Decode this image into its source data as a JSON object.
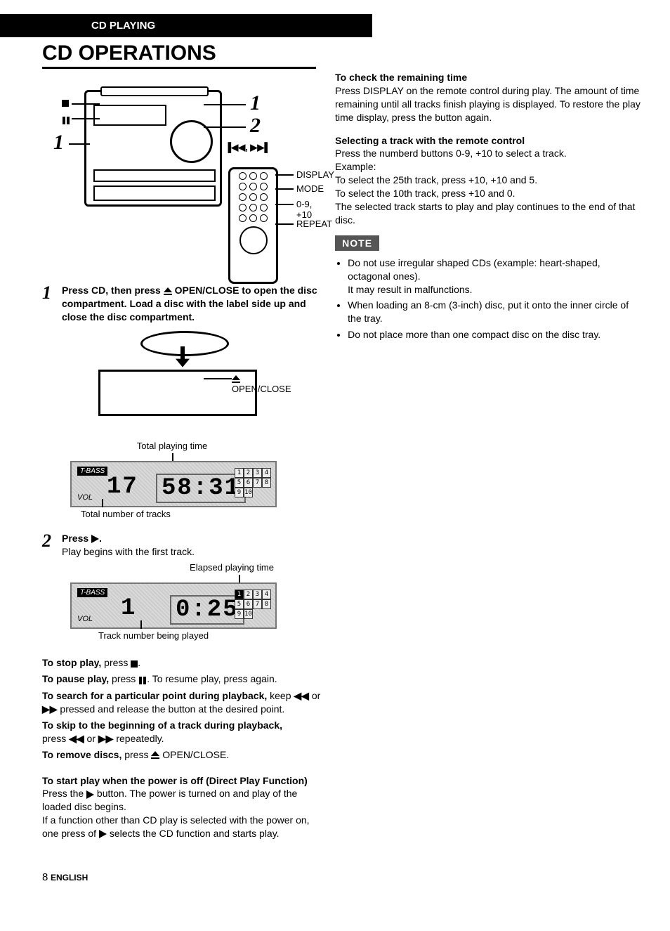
{
  "header": {
    "section": "CD PLAYING"
  },
  "title": "CD OPERATIONS",
  "diagram_main": {
    "callouts_left": {
      "stop": "■",
      "pause": "❙❙",
      "num_left": "1"
    },
    "callouts_right": {
      "num1": "1",
      "num2": "2",
      "skip": "▐◀◀, ▶▶▌",
      "display": "DISPLAY",
      "mode": "MODE",
      "digits": "0-9, +10",
      "repeat": "REPEAT"
    }
  },
  "step1": {
    "num": "1",
    "bold": "Press CD, then press ",
    "eject_label": " OPEN/CLOSE to open the disc compartment.  Load a disc with the label side up and close the disc compartment."
  },
  "load": {
    "open_close": "OPEN/CLOSE"
  },
  "lcd1": {
    "caption_top": "Total playing time",
    "tbass": "T-BASS",
    "vol": "VOL",
    "tracks": "17",
    "time": "58:31",
    "grid": [
      [
        "1",
        "2",
        "3",
        "4"
      ],
      [
        "5",
        "6",
        "7",
        "8"
      ],
      [
        "9",
        "10",
        "",
        ""
      ]
    ],
    "caption_bottom": "Total number of tracks"
  },
  "step2": {
    "num": "2",
    "bold_pre": "Press ",
    "bold_post": ".",
    "line": "Play begins with the first track."
  },
  "lcd2": {
    "caption_top": "Elapsed playing time",
    "tbass": "T-BASS",
    "vol": "VOL",
    "track": "1",
    "time": "0:25",
    "grid": [
      [
        "1",
        "2",
        "3",
        "4"
      ],
      [
        "5",
        "6",
        "7",
        "8"
      ],
      [
        "9",
        "10",
        "",
        ""
      ]
    ],
    "caption_bottom": "Track number being played"
  },
  "controls": {
    "stop_b": "To stop play,",
    "stop_t": " press ",
    "pause_b": "To pause play,",
    "pause_t": " press ",
    "pause_t2": ". To resume play, press again.",
    "search_b": "To search for a particular point during playback,",
    "search_t1": " keep ",
    "search_t2": " or ",
    "search_t3": " pressed and release the button at the desired point.",
    "skip_b": "To skip to the beginning of a track during playback,",
    "skip_t1": "press ",
    "skip_t2": " or ",
    "skip_t3": " repeatedly.",
    "remove_b": "To remove discs,",
    "remove_t": " press ",
    "remove_label": " OPEN/CLOSE."
  },
  "direct_play": {
    "heading": "To start play when the power is off (Direct Play Function)",
    "line1a": "Press the ",
    "line1b": " button. The power is turned on and play of the loaded disc begins.",
    "line2a": "If a function other than CD play is selected with the power on, one press of ",
    "line2b": " selects the CD function and starts play."
  },
  "right_col": {
    "check_time_h": "To check the remaining time",
    "check_time_p": "Press DISPLAY on the remote control during play. The amount of time remaining until all tracks finish playing is displayed. To restore the play time display, press the button again.",
    "select_h": "Selecting a track with the remote control",
    "select_p1": "Press the numberd buttons 0-9, +10 to select a track.",
    "select_ex": "Example:",
    "select_p2": "To select the 25th track, press +10, +10 and 5.",
    "select_p3": "To select the 10th track, press +10 and 0.",
    "select_p4": "The selected track starts to play and play continues to the end of that disc.",
    "note_label": "NOTE",
    "notes": [
      {
        "main": "Do not use irregular shaped CDs (example: heart-shaped, octagonal ones).",
        "sub": "It may result in malfunctions."
      },
      {
        "main": "When loading an 8-cm (3-inch) disc, put it onto the inner circle of the tray."
      },
      {
        "main": "Do not place more than one compact disc on the disc tray."
      }
    ]
  },
  "footer": {
    "page": "8",
    "lang": "ENGLISH"
  }
}
